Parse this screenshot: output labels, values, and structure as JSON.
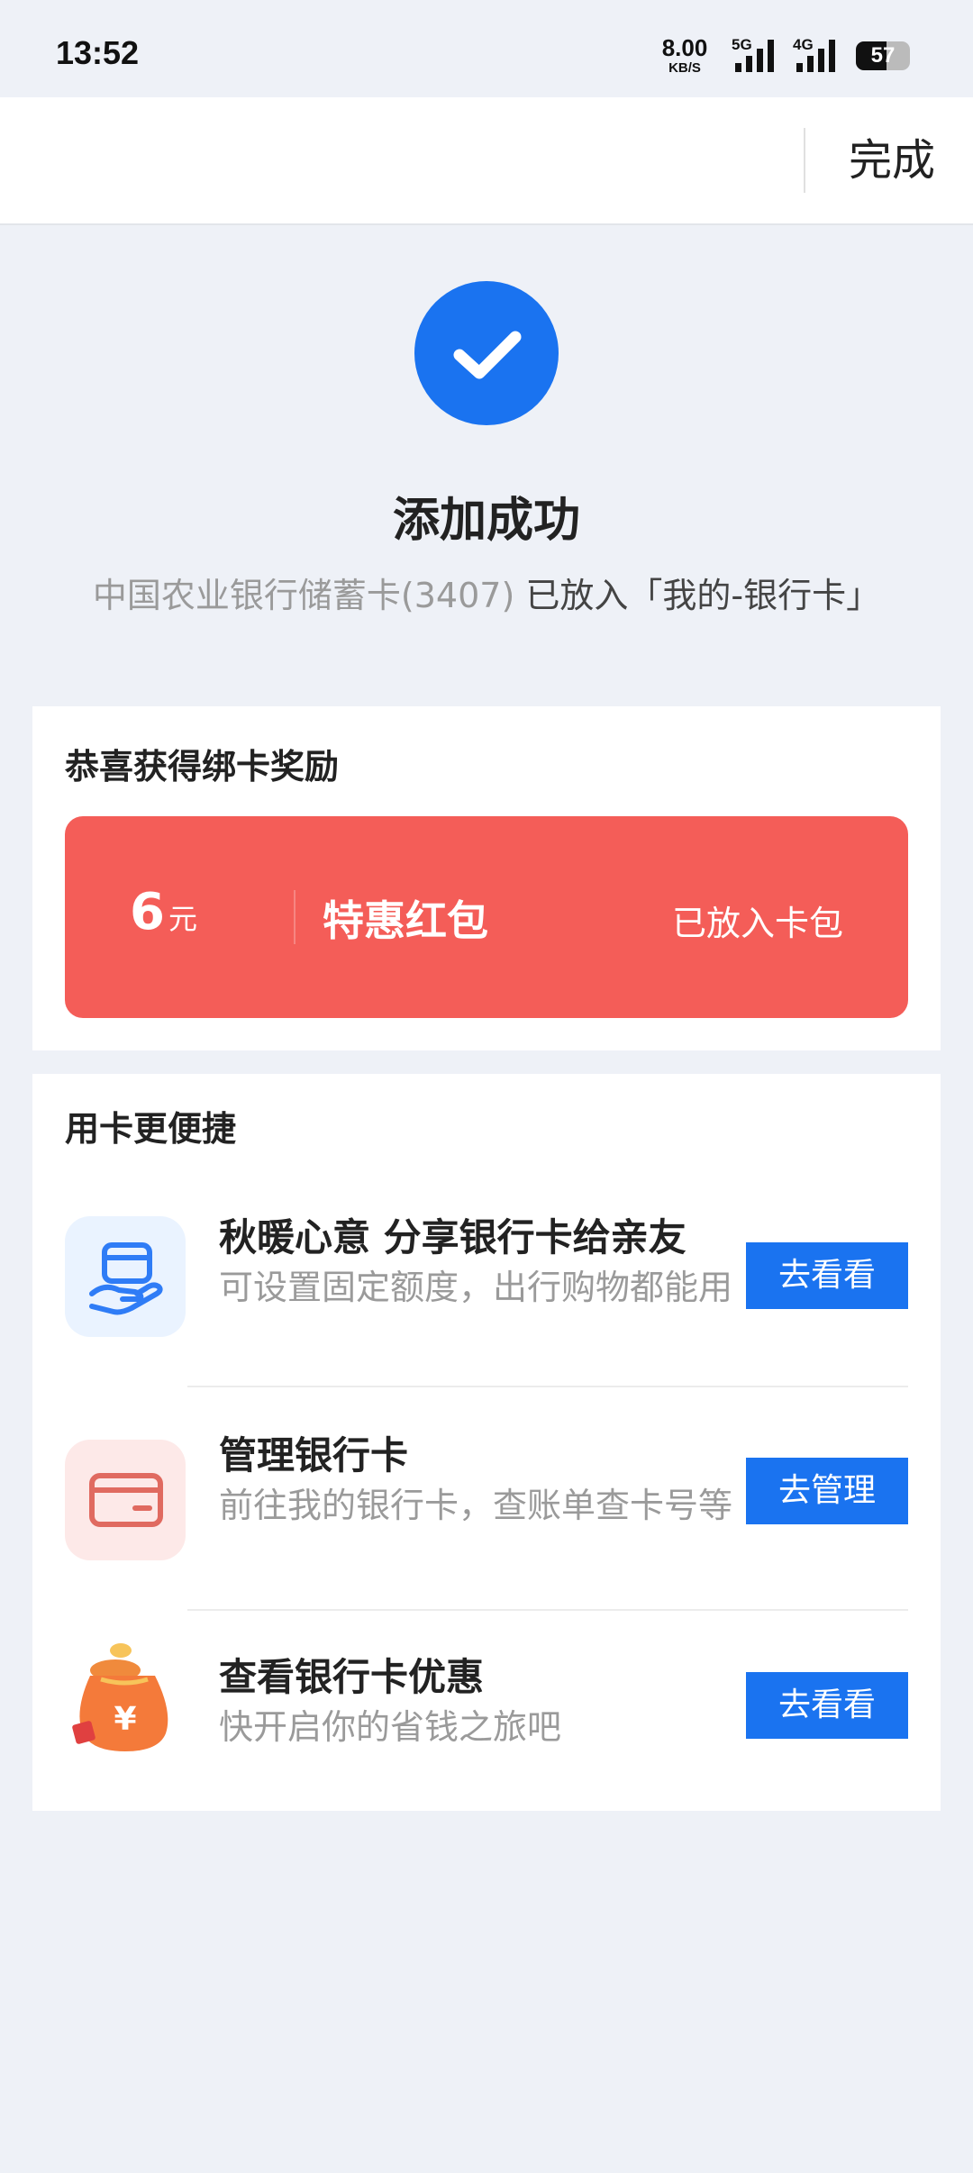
{
  "status_bar": {
    "time": "13:52",
    "net_speed_value": "8.00",
    "net_speed_unit": "KB/S",
    "signal_1_label": "5G",
    "signal_2_label": "4G",
    "battery_level": 57
  },
  "header": {
    "done_label": "完成"
  },
  "success": {
    "icon": "check-icon",
    "accent_color": "#1a73f0",
    "title": "添加成功",
    "card_info": "中国农业银行储蓄卡(3407)",
    "placed_text": "已放入「我的-银行卡」"
  },
  "reward": {
    "title": "恭喜获得绑卡奖励",
    "amount": "6",
    "unit": "元",
    "name": "特惠红包",
    "status": "已放入卡包",
    "color": "#f45d58"
  },
  "features": {
    "title": "用卡更便捷",
    "items": [
      {
        "icon": "share-card-icon",
        "title": "秋暖心意 分享银行卡给亲友",
        "desc": "可设置固定额度，出行购物都能用",
        "button": "去看看"
      },
      {
        "icon": "bank-card-icon",
        "title": "管理银行卡",
        "desc": "前往我的银行卡，查账单查卡号等",
        "button": "去管理"
      },
      {
        "icon": "money-bag-icon",
        "title": "查看银行卡优惠",
        "desc": "快开启你的省钱之旅吧",
        "button": "去看看"
      }
    ]
  }
}
